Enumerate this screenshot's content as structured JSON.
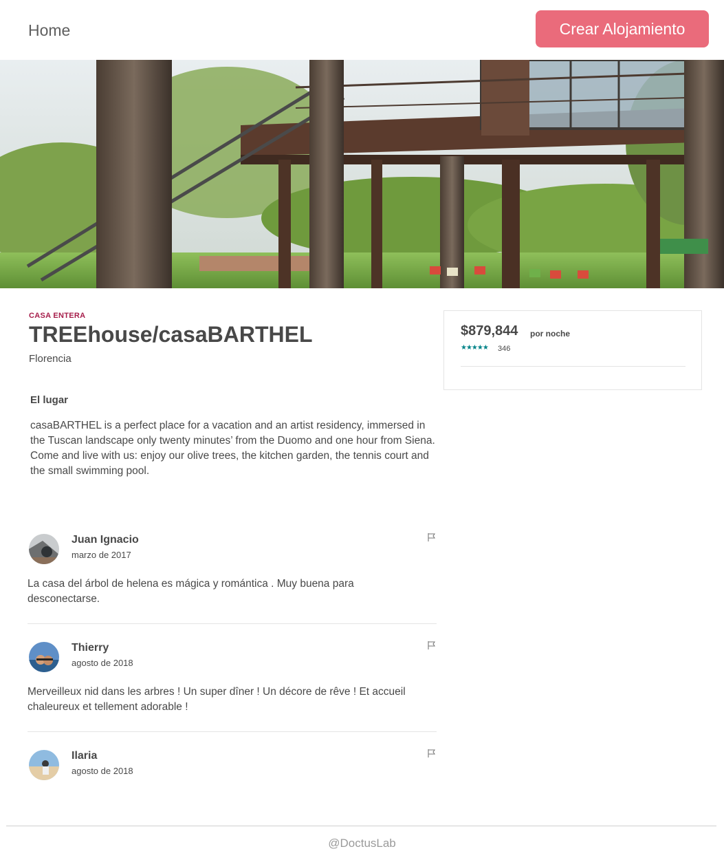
{
  "header": {
    "home_label": "Home",
    "create_button_label": "Crear Alojamiento"
  },
  "listing": {
    "kind": "CASA ENTERA",
    "title": "TREEhouse/casaBARTHEL",
    "city": "Florencia",
    "place_heading": "El lugar",
    "description": "casaBARTHEL is a perfect place for a vacation and an artist residency, immersed in the Tuscan landscape only twenty minutes’ from the Duomo and one hour from Siena. Come and live with us: enjoy our olive trees, the kitchen garden, the tennis court and the small swimming pool."
  },
  "booking": {
    "price": "$879,844",
    "per_night": "por noche",
    "stars": "★★★★★",
    "rating_count": "346",
    "rating_value": 5
  },
  "reviews": [
    {
      "name": "Juan Ignacio",
      "date": "marzo de 2017",
      "text": "La casa del árbol de helena es mágica y romántica . Muy buena para desconectarse."
    },
    {
      "name": "Thierry",
      "date": "agosto de 2018",
      "text": "Merveilleux nid dans les arbres ! Un super dîner ! Un décore de rêve ! Et accueil chaleureux et tellement adorable !"
    },
    {
      "name": "Ilaria",
      "date": "agosto de 2018",
      "text": ""
    }
  ],
  "footer": {
    "credit": "@DoctusLab"
  },
  "colors": {
    "accent": "#ea6b7b",
    "kind_label": "#a61d4a",
    "stars": "#008489"
  }
}
